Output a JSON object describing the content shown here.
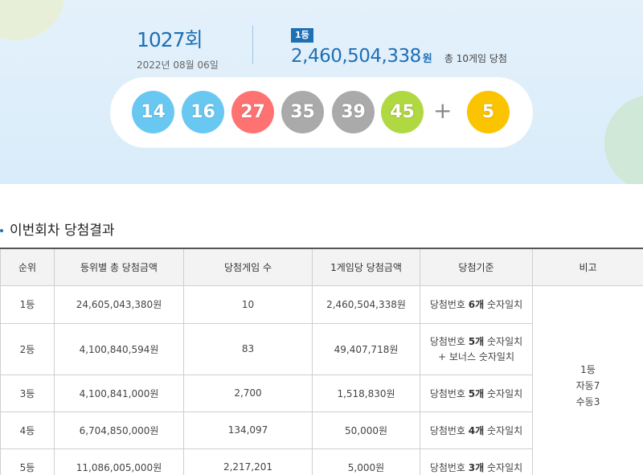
{
  "banner": {
    "round": "1027회",
    "date": "2022년 08월 06일",
    "first_prize": {
      "badge": "1등",
      "amount": "2,460,504,338",
      "unit": "원",
      "winners": "총 10게임 당첨"
    },
    "balls": [
      {
        "number": "14",
        "color": "#69c8f2"
      },
      {
        "number": "16",
        "color": "#69c8f2"
      },
      {
        "number": "27",
        "color": "#ff7272"
      },
      {
        "number": "35",
        "color": "#aaaaaa"
      },
      {
        "number": "39",
        "color": "#aaaaaa"
      },
      {
        "number": "45",
        "color": "#b0d840"
      }
    ],
    "plus": "+",
    "bonus_ball": {
      "number": "5",
      "color": "#fbc400"
    }
  },
  "section": {
    "title": "이번회차 당첨결과"
  },
  "table": {
    "headers": [
      "순위",
      "등위별 총 당첨금액",
      "당첨게임 수",
      "1게임당 당첨금액",
      "당첨기준",
      "비고"
    ],
    "rows": [
      {
        "rank": "1등",
        "total": "24,605,043,380원",
        "games": "10",
        "per_game": "2,460,504,338원",
        "crit_pre": "당첨번호 ",
        "crit_bold": "6개",
        "crit_post": " 숫자일치",
        "crit_extra": ""
      },
      {
        "rank": "2등",
        "total": "4,100,840,594원",
        "games": "83",
        "per_game": "49,407,718원",
        "crit_pre": "당첨번호 ",
        "crit_bold": "5개",
        "crit_post": " 숫자일치",
        "crit_extra": "+ 보너스 숫자일치"
      },
      {
        "rank": "3등",
        "total": "4,100,841,000원",
        "games": "2,700",
        "per_game": "1,518,830원",
        "crit_pre": "당첨번호 ",
        "crit_bold": "5개",
        "crit_post": " 숫자일치",
        "crit_extra": ""
      },
      {
        "rank": "4등",
        "total": "6,704,850,000원",
        "games": "134,097",
        "per_game": "50,000원",
        "crit_pre": "당첨번호 ",
        "crit_bold": "4개",
        "crit_post": " 숫자일치",
        "crit_extra": ""
      },
      {
        "rank": "5등",
        "total": "11,086,005,000원",
        "games": "2,217,201",
        "per_game": "5,000원",
        "crit_pre": "당첨번호 ",
        "crit_bold": "3개",
        "crit_post": " 숫자일치",
        "crit_extra": ""
      }
    ],
    "note": {
      "line1": "1등",
      "line2": "자동7",
      "line3": "수동3"
    }
  }
}
